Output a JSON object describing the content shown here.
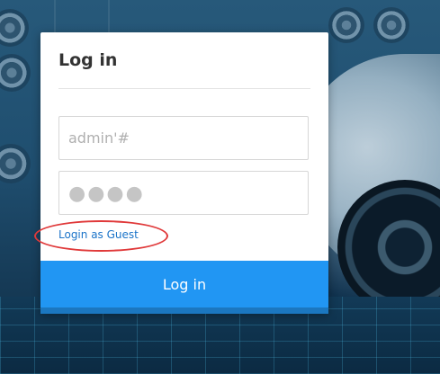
{
  "login": {
    "title": "Log in",
    "username_placeholder": "admin'#",
    "password_mask": "●●●●",
    "guest_link": "Login as Guest",
    "submit_label": "Log in"
  },
  "colors": {
    "accent": "#2196f3",
    "link": "#1a73c8",
    "highlight_ring": "#e0393a"
  },
  "icons": []
}
